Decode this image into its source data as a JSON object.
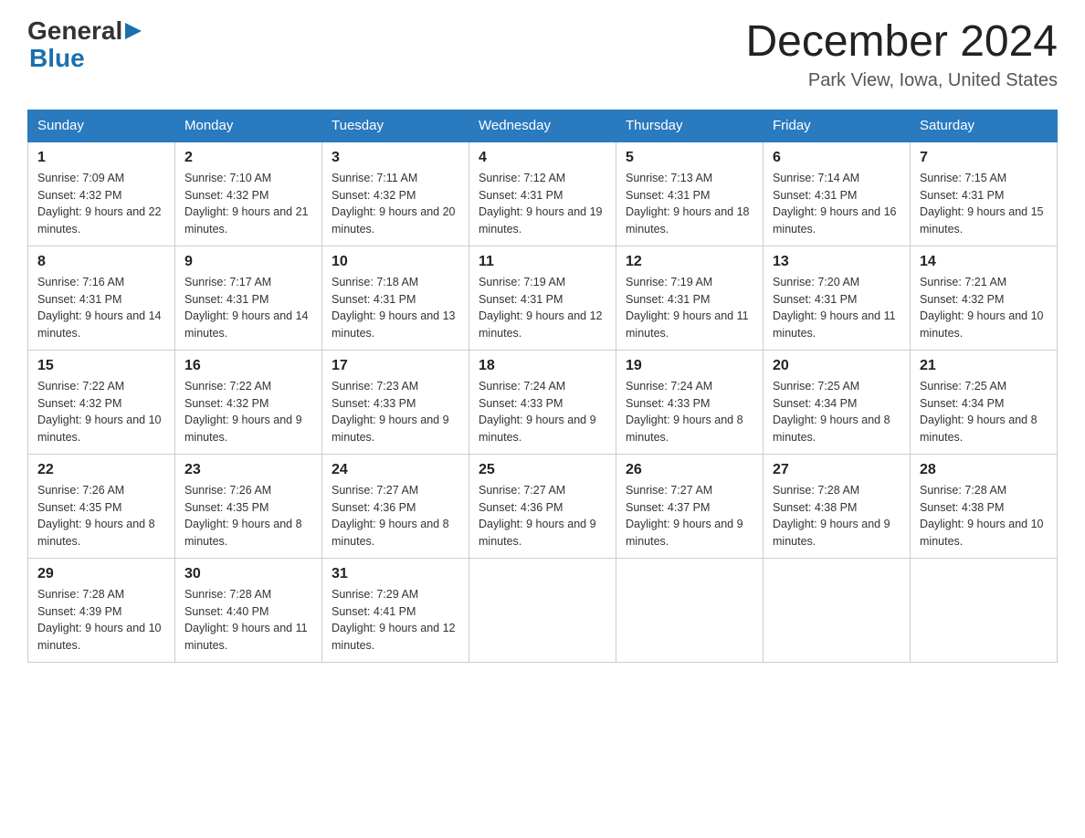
{
  "header": {
    "logo": {
      "general": "General",
      "blue": "Blue"
    },
    "title": "December 2024",
    "location": "Park View, Iowa, United States"
  },
  "calendar": {
    "days_of_week": [
      "Sunday",
      "Monday",
      "Tuesday",
      "Wednesday",
      "Thursday",
      "Friday",
      "Saturday"
    ],
    "weeks": [
      [
        {
          "day": "1",
          "sunrise": "7:09 AM",
          "sunset": "4:32 PM",
          "daylight": "9 hours and 22 minutes."
        },
        {
          "day": "2",
          "sunrise": "7:10 AM",
          "sunset": "4:32 PM",
          "daylight": "9 hours and 21 minutes."
        },
        {
          "day": "3",
          "sunrise": "7:11 AM",
          "sunset": "4:32 PM",
          "daylight": "9 hours and 20 minutes."
        },
        {
          "day": "4",
          "sunrise": "7:12 AM",
          "sunset": "4:31 PM",
          "daylight": "9 hours and 19 minutes."
        },
        {
          "day": "5",
          "sunrise": "7:13 AM",
          "sunset": "4:31 PM",
          "daylight": "9 hours and 18 minutes."
        },
        {
          "day": "6",
          "sunrise": "7:14 AM",
          "sunset": "4:31 PM",
          "daylight": "9 hours and 16 minutes."
        },
        {
          "day": "7",
          "sunrise": "7:15 AM",
          "sunset": "4:31 PM",
          "daylight": "9 hours and 15 minutes."
        }
      ],
      [
        {
          "day": "8",
          "sunrise": "7:16 AM",
          "sunset": "4:31 PM",
          "daylight": "9 hours and 14 minutes."
        },
        {
          "day": "9",
          "sunrise": "7:17 AM",
          "sunset": "4:31 PM",
          "daylight": "9 hours and 14 minutes."
        },
        {
          "day": "10",
          "sunrise": "7:18 AM",
          "sunset": "4:31 PM",
          "daylight": "9 hours and 13 minutes."
        },
        {
          "day": "11",
          "sunrise": "7:19 AM",
          "sunset": "4:31 PM",
          "daylight": "9 hours and 12 minutes."
        },
        {
          "day": "12",
          "sunrise": "7:19 AM",
          "sunset": "4:31 PM",
          "daylight": "9 hours and 11 minutes."
        },
        {
          "day": "13",
          "sunrise": "7:20 AM",
          "sunset": "4:31 PM",
          "daylight": "9 hours and 11 minutes."
        },
        {
          "day": "14",
          "sunrise": "7:21 AM",
          "sunset": "4:32 PM",
          "daylight": "9 hours and 10 minutes."
        }
      ],
      [
        {
          "day": "15",
          "sunrise": "7:22 AM",
          "sunset": "4:32 PM",
          "daylight": "9 hours and 10 minutes."
        },
        {
          "day": "16",
          "sunrise": "7:22 AM",
          "sunset": "4:32 PM",
          "daylight": "9 hours and 9 minutes."
        },
        {
          "day": "17",
          "sunrise": "7:23 AM",
          "sunset": "4:33 PM",
          "daylight": "9 hours and 9 minutes."
        },
        {
          "day": "18",
          "sunrise": "7:24 AM",
          "sunset": "4:33 PM",
          "daylight": "9 hours and 9 minutes."
        },
        {
          "day": "19",
          "sunrise": "7:24 AM",
          "sunset": "4:33 PM",
          "daylight": "9 hours and 8 minutes."
        },
        {
          "day": "20",
          "sunrise": "7:25 AM",
          "sunset": "4:34 PM",
          "daylight": "9 hours and 8 minutes."
        },
        {
          "day": "21",
          "sunrise": "7:25 AM",
          "sunset": "4:34 PM",
          "daylight": "9 hours and 8 minutes."
        }
      ],
      [
        {
          "day": "22",
          "sunrise": "7:26 AM",
          "sunset": "4:35 PM",
          "daylight": "9 hours and 8 minutes."
        },
        {
          "day": "23",
          "sunrise": "7:26 AM",
          "sunset": "4:35 PM",
          "daylight": "9 hours and 8 minutes."
        },
        {
          "day": "24",
          "sunrise": "7:27 AM",
          "sunset": "4:36 PM",
          "daylight": "9 hours and 8 minutes."
        },
        {
          "day": "25",
          "sunrise": "7:27 AM",
          "sunset": "4:36 PM",
          "daylight": "9 hours and 9 minutes."
        },
        {
          "day": "26",
          "sunrise": "7:27 AM",
          "sunset": "4:37 PM",
          "daylight": "9 hours and 9 minutes."
        },
        {
          "day": "27",
          "sunrise": "7:28 AM",
          "sunset": "4:38 PM",
          "daylight": "9 hours and 9 minutes."
        },
        {
          "day": "28",
          "sunrise": "7:28 AM",
          "sunset": "4:38 PM",
          "daylight": "9 hours and 10 minutes."
        }
      ],
      [
        {
          "day": "29",
          "sunrise": "7:28 AM",
          "sunset": "4:39 PM",
          "daylight": "9 hours and 10 minutes."
        },
        {
          "day": "30",
          "sunrise": "7:28 AM",
          "sunset": "4:40 PM",
          "daylight": "9 hours and 11 minutes."
        },
        {
          "day": "31",
          "sunrise": "7:29 AM",
          "sunset": "4:41 PM",
          "daylight": "9 hours and 12 minutes."
        },
        null,
        null,
        null,
        null
      ]
    ]
  }
}
